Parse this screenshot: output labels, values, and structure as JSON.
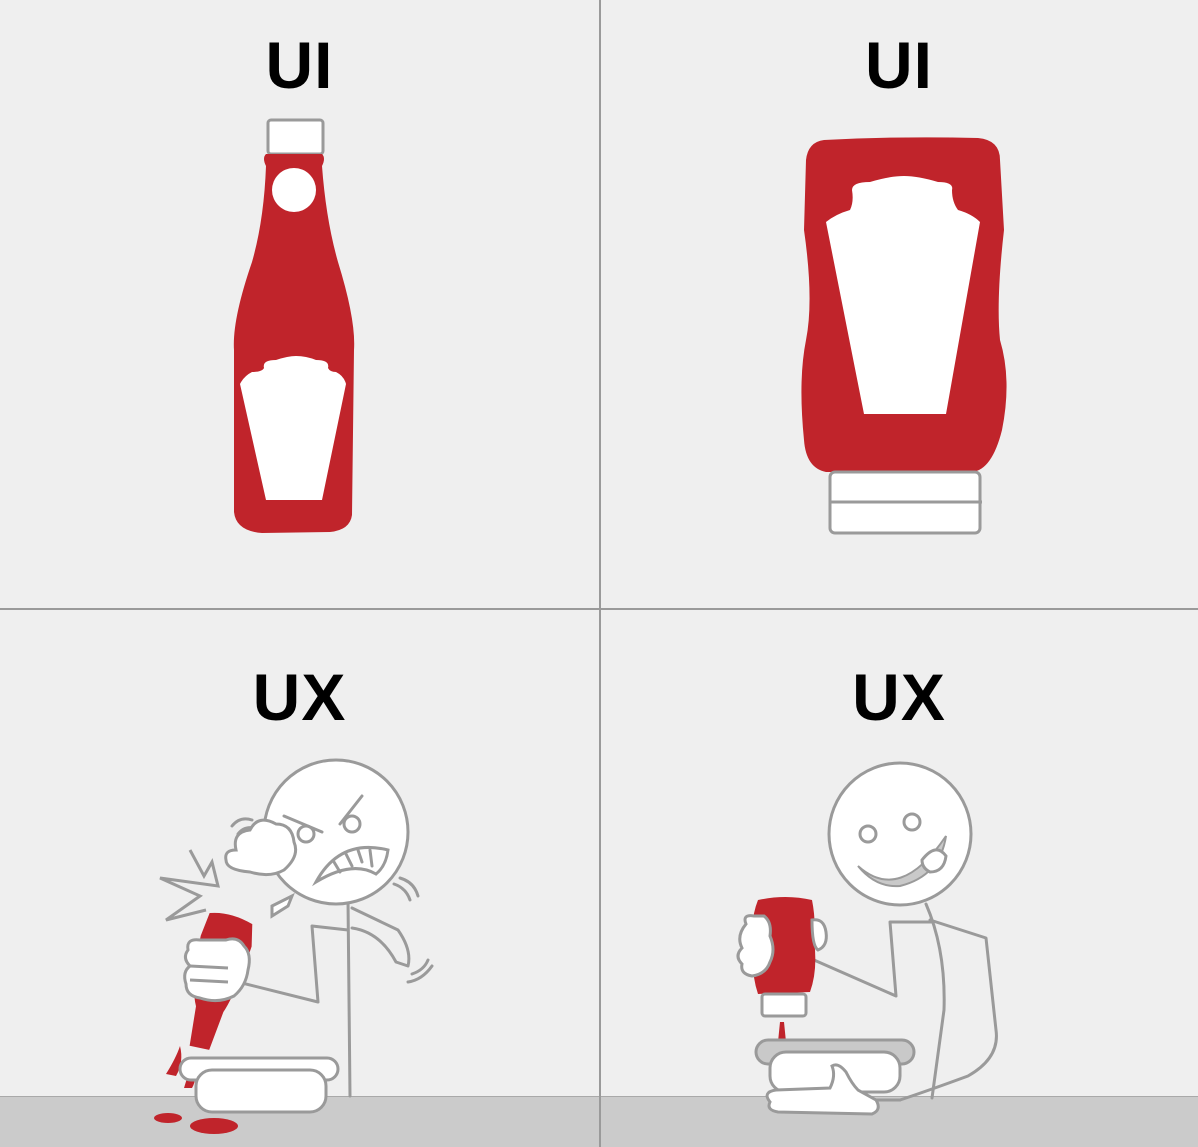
{
  "panels": {
    "top_left": {
      "label": "UI"
    },
    "top_right": {
      "label": "UI"
    },
    "bottom_left": {
      "label": "UX"
    },
    "bottom_right": {
      "label": "UX"
    }
  },
  "colors": {
    "ketchup_red": "#c0242b",
    "background": "#efefef",
    "outline_gray": "#9a9a9a",
    "floor": "#cbcbcb"
  }
}
